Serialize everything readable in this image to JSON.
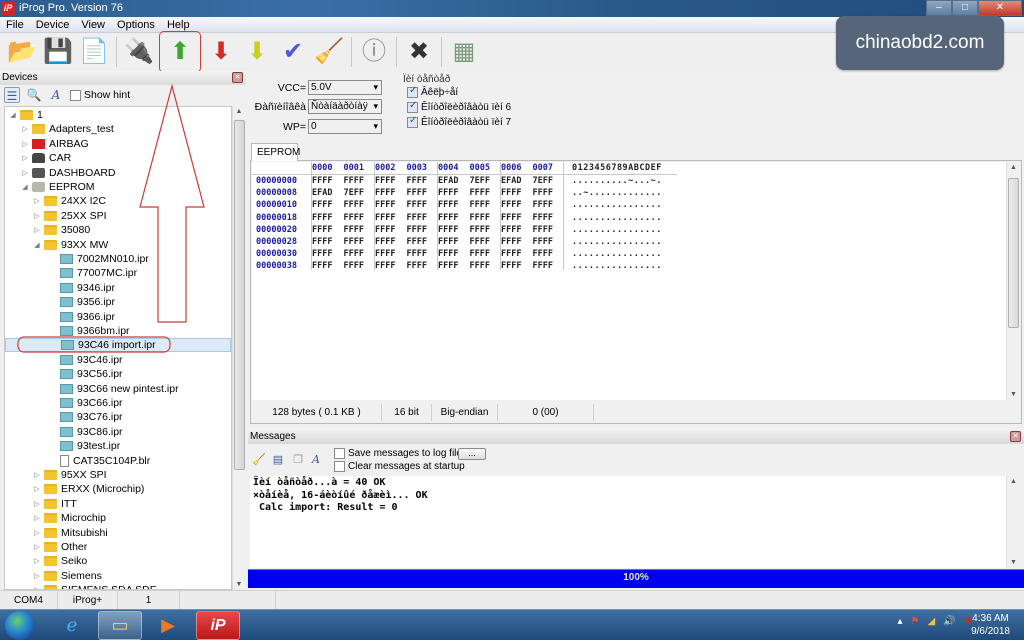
{
  "window": {
    "title": "iProg Pro. Version 76",
    "app_icon": "iP",
    "controls": {
      "minimize": "–",
      "maximize": "□",
      "close": "✕"
    }
  },
  "menu": [
    "File",
    "Device",
    "View",
    "Options",
    "Help"
  ],
  "toolbar": {
    "buttons": [
      {
        "name": "open-icon",
        "glyph": "📂"
      },
      {
        "name": "save-icon",
        "glyph": "💾"
      },
      {
        "name": "new-file-icon",
        "glyph": "📄"
      },
      {
        "name": "chip-icon",
        "glyph": "🔌"
      },
      {
        "name": "read-up-arrow-icon",
        "glyph": "⬆",
        "color": "#3aa82a",
        "highlighted": true
      },
      {
        "name": "write-down-arrow-icon",
        "glyph": "⬇",
        "color": "#d82a22"
      },
      {
        "name": "verify-down-arrow-icon",
        "glyph": "⬇",
        "color": "#c8d020"
      },
      {
        "name": "check-icon",
        "glyph": "✔",
        "color": "#4a5ad8"
      },
      {
        "name": "erase-broom-icon",
        "glyph": "🧹"
      },
      {
        "name": "info-icon",
        "glyph": "ⓘ",
        "color": "#888888"
      },
      {
        "name": "cancel-x-icon",
        "glyph": "✖",
        "color": "#333333"
      },
      {
        "name": "calculator-icon",
        "glyph": "▦",
        "color": "#7a9a7a"
      }
    ]
  },
  "watermark": "chinaobd2.com",
  "devices": {
    "title": "Devices",
    "show_hint_label": "Show hint",
    "show_hint_checked": false,
    "tree": [
      {
        "label": "1",
        "level": 0,
        "icon": "folder",
        "expanded": true
      },
      {
        "label": "Adapters_test",
        "level": 1,
        "icon": "folder"
      },
      {
        "label": "AIRBAG",
        "level": 1,
        "icon": "airbag"
      },
      {
        "label": "CAR",
        "level": 1,
        "icon": "car"
      },
      {
        "label": "DASHBOARD",
        "level": 1,
        "icon": "dash"
      },
      {
        "label": "EEPROM",
        "level": 1,
        "icon": "chip",
        "expanded": true
      },
      {
        "label": "24XX I2C",
        "level": 2,
        "icon": "folder"
      },
      {
        "label": "25XX SPI",
        "level": 2,
        "icon": "folder"
      },
      {
        "label": "35080",
        "level": 2,
        "icon": "folder"
      },
      {
        "label": "93XX MW",
        "level": 2,
        "icon": "folder",
        "expanded": true
      },
      {
        "label": "7002MN010.ipr",
        "level": 3,
        "icon": "file"
      },
      {
        "label": "77007MC.ipr",
        "level": 3,
        "icon": "file"
      },
      {
        "label": "9346.ipr",
        "level": 3,
        "icon": "file"
      },
      {
        "label": "9356.ipr",
        "level": 3,
        "icon": "file"
      },
      {
        "label": "9366.ipr",
        "level": 3,
        "icon": "file"
      },
      {
        "label": "9366bm.ipr",
        "level": 3,
        "icon": "file"
      },
      {
        "label": "93C46 import.ipr",
        "level": 3,
        "icon": "file",
        "selected": true
      },
      {
        "label": "93C46.ipr",
        "level": 3,
        "icon": "file"
      },
      {
        "label": "93C56.ipr",
        "level": 3,
        "icon": "file"
      },
      {
        "label": "93C66 new pintest.ipr",
        "level": 3,
        "icon": "file"
      },
      {
        "label": "93C66.ipr",
        "level": 3,
        "icon": "file"
      },
      {
        "label": "93C76.ipr",
        "level": 3,
        "icon": "file"
      },
      {
        "label": "93C86.ipr",
        "level": 3,
        "icon": "file"
      },
      {
        "label": "93test.ipr",
        "level": 3,
        "icon": "file"
      },
      {
        "label": "CAT35C104P.blr",
        "level": 3,
        "icon": "doc"
      },
      {
        "label": "95XX SPI",
        "level": 2,
        "icon": "folder"
      },
      {
        "label": "ERXX (Microchip)",
        "level": 2,
        "icon": "folder"
      },
      {
        "label": "ITT",
        "level": 2,
        "icon": "folder"
      },
      {
        "label": "Microchip",
        "level": 2,
        "icon": "folder"
      },
      {
        "label": "Mitsubishi",
        "level": 2,
        "icon": "folder"
      },
      {
        "label": "Other",
        "level": 2,
        "icon": "folder"
      },
      {
        "label": "Seiko",
        "level": 2,
        "icon": "folder"
      },
      {
        "label": "Siemens",
        "level": 2,
        "icon": "folder"
      },
      {
        "label": "SIEMENS SDA SDE",
        "level": 2,
        "icon": "folder"
      }
    ]
  },
  "settings": {
    "vcc_label": "VCC=",
    "vcc_value": "5.0V",
    "org_label": "Ðàñïèíîâêà",
    "org_value": "Ñòàíäàðòíàÿ",
    "wp_label": "WP=",
    "wp_value": "0",
    "group_title": "Ïèí òåñòåð",
    "options": [
      {
        "label": "Âêëþ÷åí",
        "checked": true
      },
      {
        "label": "Êîíòðîëèðîâàòü ïèí 6",
        "checked": true
      },
      {
        "label": "Êîíòðîëèðîâàòü ïèí 7",
        "checked": true
      }
    ]
  },
  "editor": {
    "tab": "EEPROM",
    "header_cols": [
      "0000",
      "0001",
      "0002",
      "0003",
      "0004",
      "0005",
      "0006",
      "0007"
    ],
    "ascii_header": "0123456789ABCDEF",
    "rows": [
      {
        "addr": "00000000",
        "words": [
          "FFFF",
          "FFFF",
          "FFFF",
          "FFFF",
          "EFAD",
          "7EFF",
          "EFAD",
          "7EFF"
        ],
        "ascii": "..........~...~."
      },
      {
        "addr": "00000008",
        "words": [
          "EFAD",
          "7EFF",
          "FFFF",
          "FFFF",
          "FFFF",
          "FFFF",
          "FFFF",
          "FFFF"
        ],
        "ascii": "..~............."
      },
      {
        "addr": "00000010",
        "words": [
          "FFFF",
          "FFFF",
          "FFFF",
          "FFFF",
          "FFFF",
          "FFFF",
          "FFFF",
          "FFFF"
        ],
        "ascii": "................"
      },
      {
        "addr": "00000018",
        "words": [
          "FFFF",
          "FFFF",
          "FFFF",
          "FFFF",
          "FFFF",
          "FFFF",
          "FFFF",
          "FFFF"
        ],
        "ascii": "................"
      },
      {
        "addr": "00000020",
        "words": [
          "FFFF",
          "FFFF",
          "FFFF",
          "FFFF",
          "FFFF",
          "FFFF",
          "FFFF",
          "FFFF"
        ],
        "ascii": "................"
      },
      {
        "addr": "00000028",
        "words": [
          "FFFF",
          "FFFF",
          "FFFF",
          "FFFF",
          "FFFF",
          "FFFF",
          "FFFF",
          "FFFF"
        ],
        "ascii": "................"
      },
      {
        "addr": "00000030",
        "words": [
          "FFFF",
          "FFFF",
          "FFFF",
          "FFFF",
          "FFFF",
          "FFFF",
          "FFFF",
          "FFFF"
        ],
        "ascii": "................"
      },
      {
        "addr": "00000038",
        "words": [
          "FFFF",
          "FFFF",
          "FFFF",
          "FFFF",
          "FFFF",
          "FFFF",
          "FFFF",
          "FFFF"
        ],
        "ascii": "................"
      }
    ],
    "status": {
      "size": "128 bytes ( 0.1 KB )",
      "width": "16 bit",
      "endian": "Big-endian",
      "value": "0 (00)"
    }
  },
  "messages": {
    "title": "Messages",
    "save_log_label": "Save messages to log file",
    "save_log_checked": false,
    "browse_label": "...",
    "clear_startup_label": "Clear messages at startup",
    "clear_startup_checked": false,
    "log": [
      "Ïèí òåñòåð...à = 40 OK",
      "×òåíèå, 16-áèòíûé ðåæèì... OK",
      " Calc import: Result = 0"
    ]
  },
  "progress": {
    "percent": 100,
    "label": "100%",
    "color": "#0000f0"
  },
  "statusbar": {
    "port": "COM4",
    "device": "iProg+",
    "count": "1"
  },
  "taskbar": {
    "time": "4:36 AM",
    "date": "9/6/2018"
  }
}
